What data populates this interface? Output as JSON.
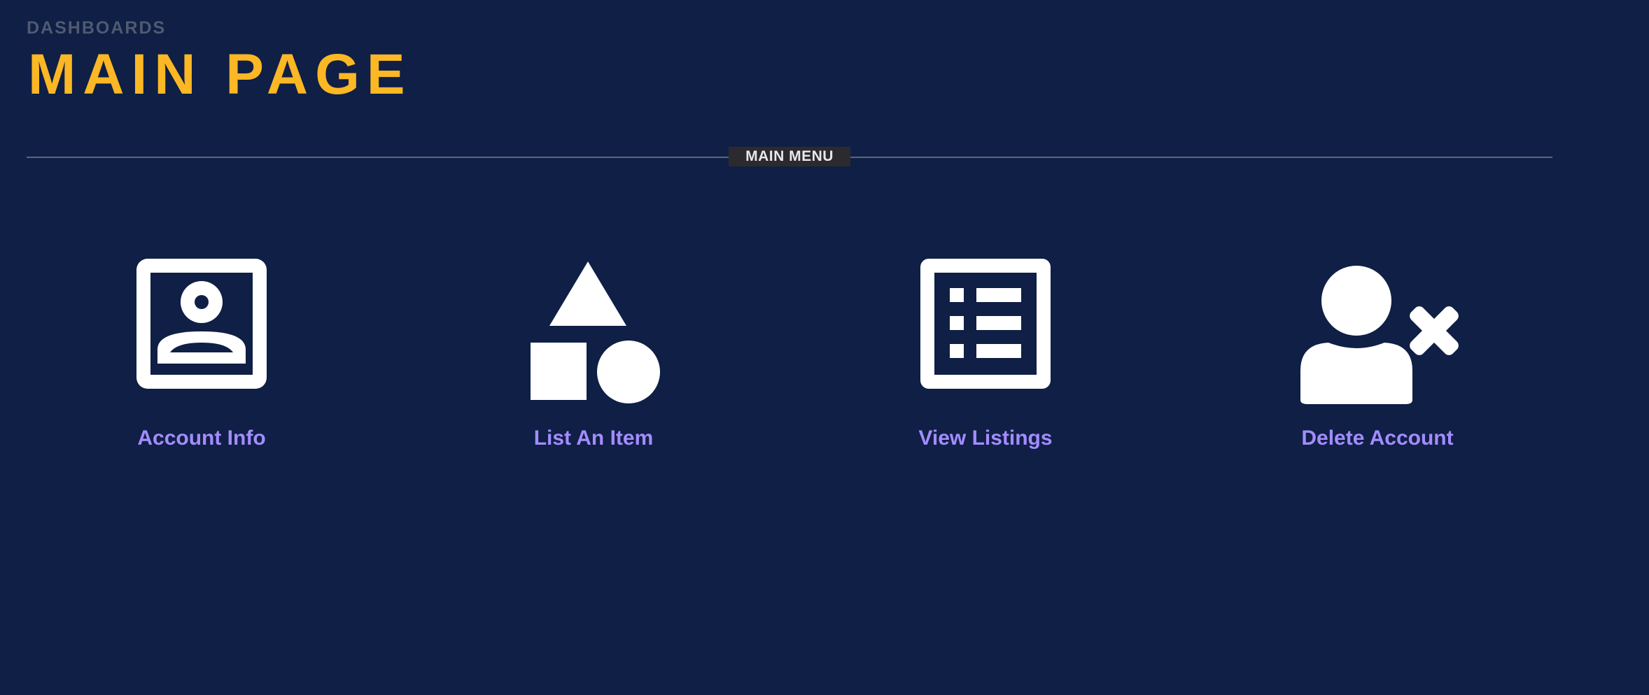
{
  "header": {
    "breadcrumb": "DASHBOARDS",
    "title": "MAIN PAGE"
  },
  "menu": {
    "section_label": "MAIN MENU",
    "items": [
      {
        "label": "Account Info",
        "icon": "account-box-icon"
      },
      {
        "label": "List An Item",
        "icon": "shapes-icon"
      },
      {
        "label": "View Listings",
        "icon": "list-icon"
      },
      {
        "label": "Delete Account",
        "icon": "person-remove-icon"
      }
    ]
  },
  "colors": {
    "background": "#0f1f45",
    "title": "#fbb724",
    "breadcrumb": "#4f5a72",
    "menu_label": "#a48cff",
    "icon": "#ffffff",
    "section_label_bg": "#2b2b2f"
  }
}
